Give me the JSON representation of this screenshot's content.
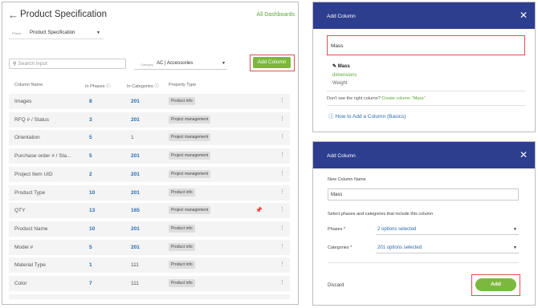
{
  "left": {
    "title": "Product Specification",
    "all_dashboards": "All Dashboards",
    "phase": {
      "label": "Phase",
      "value": "Product Specification"
    },
    "search_placeholder": "Search input",
    "category": {
      "label": "Category",
      "value": "AC | Accessories"
    },
    "add_column_label": "Add Column",
    "headers": [
      "Column Name",
      "In Phases ⓘ",
      "In Categories ⓘ",
      "Property Type"
    ],
    "rows": [
      {
        "name": "Images",
        "phases": "8",
        "categories": "201",
        "type": "Product info",
        "cat_link": true
      },
      {
        "name": "RFQ # / Status",
        "phases": "3",
        "categories": "201",
        "type": "Project management",
        "cat_link": true
      },
      {
        "name": "Orientation",
        "phases": "5",
        "categories": "1",
        "type": "Project management",
        "cat_link": false
      },
      {
        "name": "Purchase order # / Sta...",
        "phases": "5",
        "categories": "201",
        "type": "Project management",
        "cat_link": true
      },
      {
        "name": "Project Item UID",
        "phases": "2",
        "categories": "201",
        "type": "Project management",
        "cat_link": true
      },
      {
        "name": "Product Type",
        "phases": "10",
        "categories": "201",
        "type": "Product info",
        "cat_link": true
      },
      {
        "name": "QTY",
        "phases": "13",
        "categories": "165",
        "type": "Project management",
        "cat_link": true,
        "pinned": true
      },
      {
        "name": "Product Name",
        "phases": "10",
        "categories": "201",
        "type": "Product info",
        "cat_link": true
      },
      {
        "name": "Model #",
        "phases": "5",
        "categories": "201",
        "type": "Product info",
        "cat_link": true
      },
      {
        "name": "Material Type",
        "phases": "1",
        "categories": "111",
        "type": "Product info",
        "cat_link": false
      },
      {
        "name": "Color",
        "phases": "7",
        "categories": "111",
        "type": "Product info",
        "cat_link": false
      }
    ]
  },
  "add_column_search": {
    "title": "Add Column",
    "query": "Mass",
    "suggestions": [
      {
        "text": "Mass",
        "style": "bold"
      },
      {
        "text": "dimensions",
        "style": "green"
      },
      {
        "text": "Weight",
        "style": "gray"
      }
    ],
    "not_found_text": "Don't see the right column?",
    "create_link": "Create column \"Mass\"",
    "how_to": "How to Add a Column (Basics)"
  },
  "add_column_form": {
    "title": "Add Column",
    "name_label": "New Column Name",
    "name_value": "Mass",
    "select_prompt": "Select phases and categories that include this column",
    "phases_label": "Phases *",
    "phases_value": "2 options selected",
    "categories_label": "Categories *",
    "categories_value": "201 options selected",
    "discard": "Discard",
    "add": "Add"
  },
  "colors": {
    "primary": "#2d3e8f",
    "accent_green": "#7cb83d",
    "link_blue": "#2b6cb0",
    "highlight_red": "#d9534f"
  }
}
